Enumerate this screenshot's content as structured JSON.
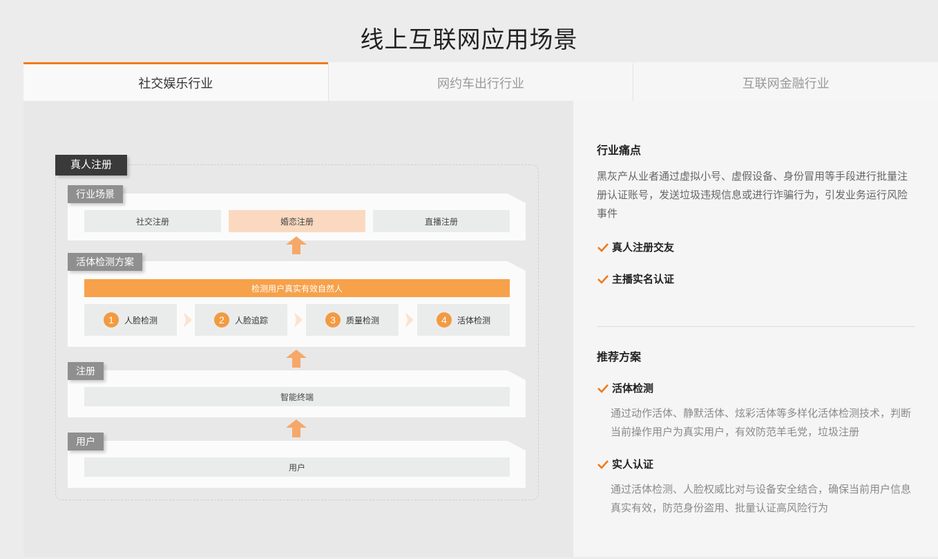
{
  "page_title": "线上互联网应用场景",
  "tabs": [
    {
      "label": "社交娱乐行业",
      "active": true
    },
    {
      "label": "网约车出行行业",
      "active": false
    },
    {
      "label": "互联网金融行业",
      "active": false
    }
  ],
  "diagram": {
    "main_tag": "真人注册",
    "scene": {
      "tag": "行业场景",
      "items": [
        "社交注册",
        "婚恋注册",
        "直播注册"
      ],
      "highlighted_index": 1
    },
    "liveness": {
      "tag": "活体检测方案",
      "banner": "检测用户真实有效自然人",
      "steps": [
        {
          "num": "1",
          "label": "人脸检测"
        },
        {
          "num": "2",
          "label": "人脸追踪"
        },
        {
          "num": "3",
          "label": "质量检测"
        },
        {
          "num": "4",
          "label": "活体检测"
        }
      ]
    },
    "register": {
      "tag": "注册",
      "item": "智能终端"
    },
    "user": {
      "tag": "用户",
      "item": "用户"
    }
  },
  "pain_points": {
    "title": "行业痛点",
    "text": "黑灰产从业者通过虚拟小号、虚假设备、身份冒用等手段进行批量注册认证账号，发送垃圾违规信息或进行诈骗行为，引发业务运行风险事件",
    "items": [
      "真人注册交友",
      "主播实名认证"
    ]
  },
  "solutions": {
    "title": "推荐方案",
    "items": [
      {
        "name": "活体检测",
        "desc": "通过动作活体、静默活体、炫彩活体等多样化活体检测技术，判断当前操作用户为真实用户，有效防范羊毛党，垃圾注册"
      },
      {
        "name": "实人认证",
        "desc": "通过活体检测、人脸权威比对与设备安全结合，确保当前用户信息真实有效，防范身份盗用、批量认证高风险行为"
      }
    ]
  },
  "colors": {
    "accent": "#f07a1a",
    "step_circle": "#f39a41",
    "banner": "#f7a14a",
    "highlight_cell": "#fad9c0"
  }
}
